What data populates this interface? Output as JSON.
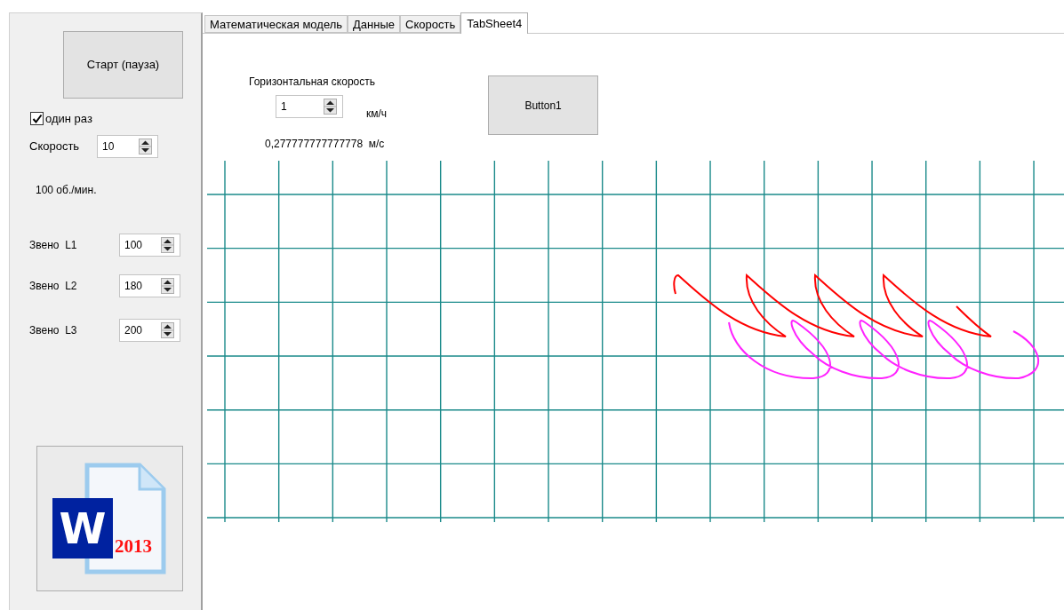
{
  "left_panel": {
    "start_button": "Старт (пауза)",
    "once_checkbox": {
      "label": "один раз",
      "checked": true
    },
    "speed": {
      "label": "Скорость",
      "value": "10"
    },
    "rpm": "100  об./мин.",
    "links": [
      {
        "label": "Звено  L1",
        "value": "100"
      },
      {
        "label": "Звено  L2",
        "value": "180"
      },
      {
        "label": "Звено  L3",
        "value": "200"
      }
    ],
    "word_button": {
      "letter": "W",
      "year": "2013"
    }
  },
  "tabs": [
    {
      "label": "Математическая модель",
      "selected": false
    },
    {
      "label": "Данные",
      "selected": false
    },
    {
      "label": "Скорость",
      "selected": false
    },
    {
      "label": "TabSheet4",
      "selected": true
    }
  ],
  "tab_sheet": {
    "horizontal_speed": {
      "label": "Горизонтальная скорость",
      "value": "1",
      "unit": "км/ч"
    },
    "button": "Button1",
    "converted": "0,277777777777778  м/с"
  }
}
